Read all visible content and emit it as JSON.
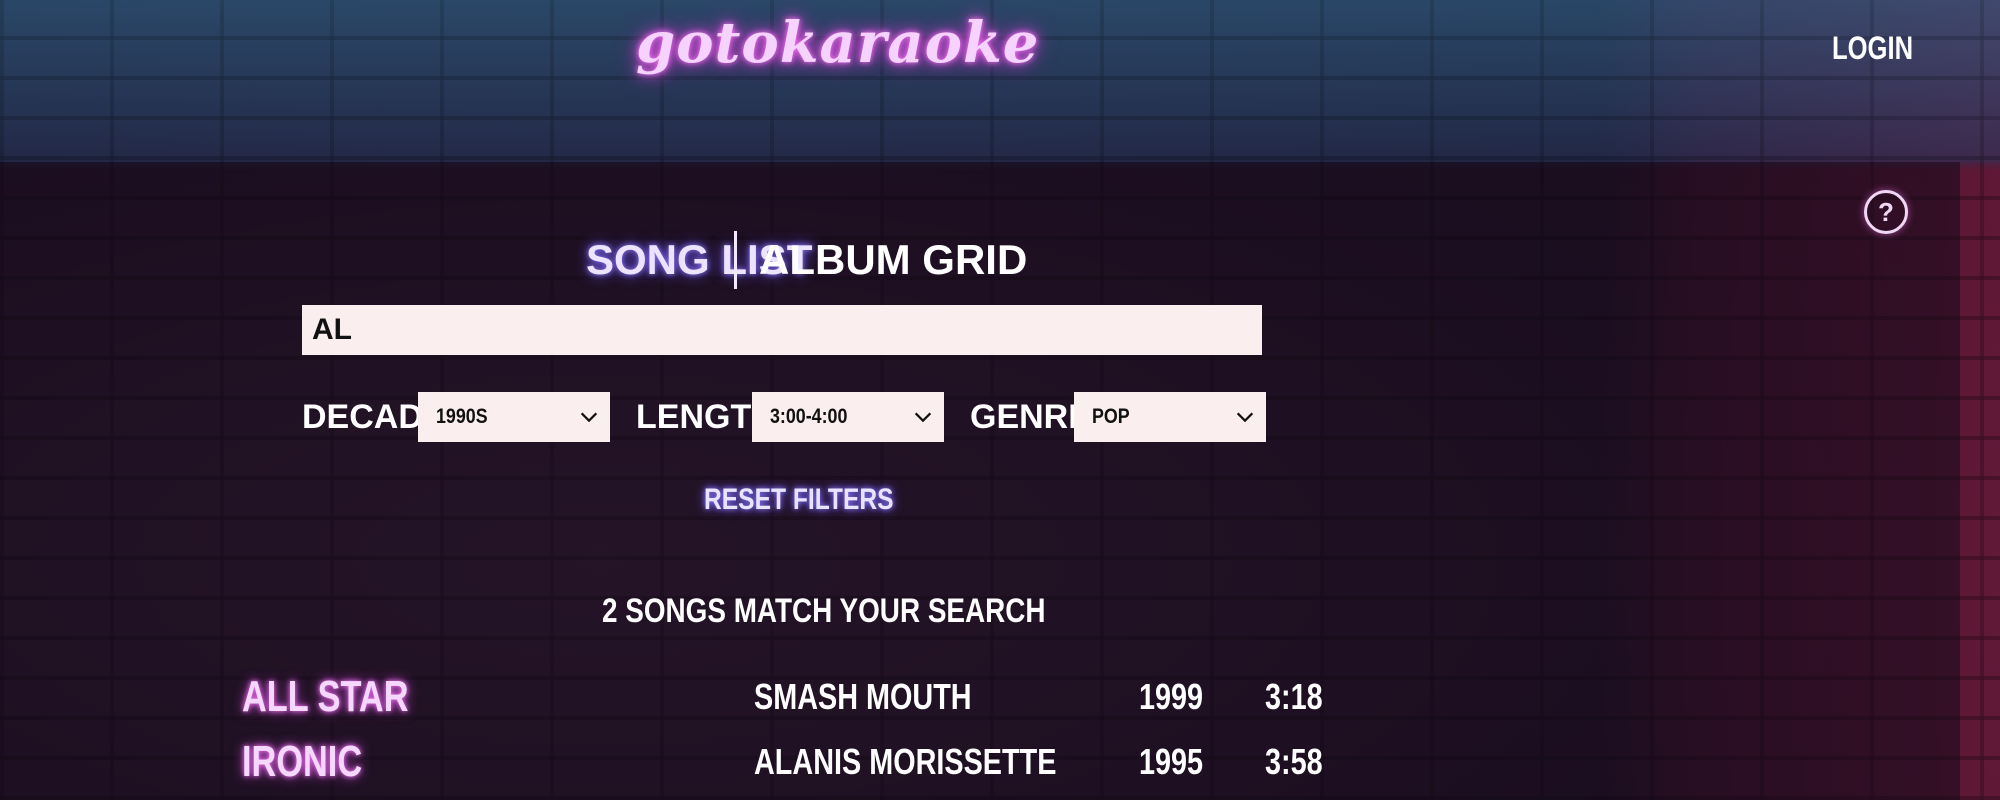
{
  "header": {
    "logo_text": "gotokaraoke",
    "login_label": "LOGIN",
    "help_glyph": "?"
  },
  "tabs": [
    {
      "label": "SONG LIST",
      "active": true
    },
    {
      "label": "ALBUM GRID",
      "active": false
    }
  ],
  "search": {
    "value": "AL",
    "placeholder": ""
  },
  "filters": {
    "decade": {
      "label": "DECADE:",
      "value": "1990S"
    },
    "length": {
      "label": "LENGTH:",
      "value": "3:00-4:00"
    },
    "genre": {
      "label": "GENRE:",
      "value": "POP"
    },
    "reset_label": "RESET FILTERS"
  },
  "results": {
    "summary": "2 SONGS MATCH YOUR SEARCH",
    "songs": [
      {
        "title": "ALL STAR",
        "artist": "SMASH MOUTH",
        "year": "1999",
        "length": "3:18"
      },
      {
        "title": "IRONIC",
        "artist": "ALANIS MORISSETTE",
        "year": "1995",
        "length": "3:58"
      }
    ]
  },
  "colors": {
    "neon_pink": "#ff7bff",
    "neon_blue": "#6a55ff",
    "input_bg": "#fbeeee"
  },
  "icons": {
    "help": "help-circle-icon",
    "dropdown": "chevron-down-icon"
  }
}
